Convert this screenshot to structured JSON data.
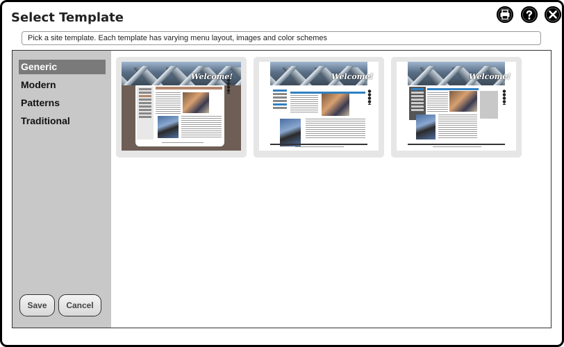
{
  "window": {
    "title": "Select Template",
    "hint": "Pick a site template. Each template has varying menu layout, images and color schemes"
  },
  "header_icons": [
    "printer-icon",
    "help-icon",
    "close-icon"
  ],
  "categories": [
    {
      "label": "Generic",
      "selected": true
    },
    {
      "label": "Modern",
      "selected": false
    },
    {
      "label": "Patterns",
      "selected": false
    },
    {
      "label": "Traditional",
      "selected": false
    }
  ],
  "templates": [
    {
      "welcome": "Welcome!",
      "background": "#6e5e56",
      "accent": "#b4876c"
    },
    {
      "welcome": "Welcome!",
      "background": "#ffffff",
      "accent": "#2f7fc1"
    },
    {
      "welcome": "Welcome!",
      "background": "#ffffff",
      "accent": "#6a6a6a"
    }
  ],
  "buttons": {
    "save": "Save",
    "cancel": "Cancel"
  },
  "colors": {
    "sidebar": "#c8c8c8",
    "selected_category": "#7a7a7a",
    "card": "#e6e6e6"
  }
}
